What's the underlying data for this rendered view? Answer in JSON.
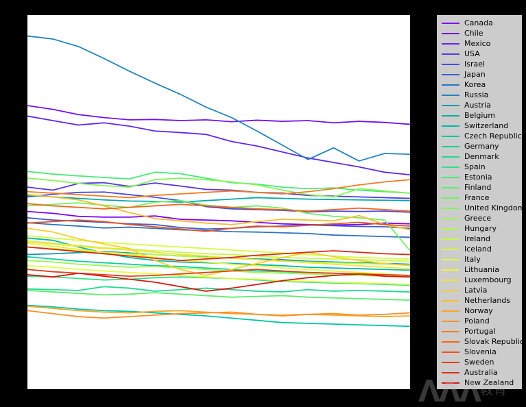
{
  "figure": {
    "background_color": "#000000",
    "plot_background_color": "#ffffff",
    "legend_background_color": "#cccccc"
  },
  "watermark": {
    "logo_text": "AAA",
    "text": "教育"
  },
  "chart_data": {
    "type": "line",
    "title": "",
    "xlabel": "",
    "ylabel": "",
    "grid": false,
    "legend_position": "right",
    "axis_ticks_visible": false,
    "axis_labels_visible": false,
    "xlim": [
      0,
      15
    ],
    "ylim": [
      0,
      100
    ],
    "x": [
      0,
      1,
      2,
      3,
      4,
      5,
      6,
      7,
      8,
      9,
      10,
      11,
      12,
      13,
      14,
      15
    ],
    "colormap": "rainbow",
    "series": [
      {
        "name": "Canada",
        "color": "#7d00ff",
        "values": [
          47.5,
          47.0,
          46.2,
          46.0,
          46.0,
          46.3,
          45.4,
          45.2,
          45.0,
          44.6,
          44.2,
          44.0,
          43.9,
          44.0,
          44.4,
          44.2
        ]
      },
      {
        "name": "Chile",
        "color": "#6f13f5",
        "values": [
          75.8,
          74.8,
          73.4,
          72.6,
          72.0,
          72.1,
          71.8,
          72.0,
          71.5,
          71.9,
          71.6,
          71.8,
          71.2,
          71.6,
          71.3,
          70.8
        ]
      },
      {
        "name": "Mexico",
        "color": "#6226ec",
        "values": [
          73.0,
          71.8,
          70.6,
          71.2,
          70.3,
          69.0,
          68.6,
          68.1,
          66.2,
          65.0,
          63.4,
          61.8,
          60.6,
          59.4,
          58.0,
          57.3
        ]
      },
      {
        "name": "USA",
        "color": "#5539e2",
        "values": [
          54.0,
          53.2,
          55.0,
          55.2,
          54.2,
          55.1,
          54.3,
          53.4,
          53.2,
          52.6,
          52.4,
          51.8,
          51.6,
          51.4,
          51.2,
          51.0
        ]
      },
      {
        "name": "Israel",
        "color": "#484cd9",
        "values": [
          51.4,
          52.1,
          52.6,
          52.7,
          52.0,
          51.3,
          50.4,
          48.8,
          48.2,
          48.0,
          47.8,
          47.4,
          47.6,
          47.5,
          47.6,
          47.3
        ]
      },
      {
        "name": "Japan",
        "color": "#3b5ecf",
        "values": [
          45.8,
          45.2,
          44.9,
          44.6,
          44.2,
          44.0,
          43.2,
          42.8,
          43.0,
          43.4,
          43.6,
          43.9,
          43.7,
          43.5,
          43.4,
          43.0
        ]
      },
      {
        "name": "Korea",
        "color": "#2e71c5",
        "values": [
          44.5,
          44.0,
          43.6,
          43.1,
          43.3,
          43.0,
          42.6,
          42.4,
          42.1,
          42.0,
          41.8,
          41.6,
          41.2,
          41.0,
          40.8,
          40.6
        ]
      },
      {
        "name": "Russia",
        "color": "#2184bb",
        "values": [
          94.4,
          93.6,
          91.6,
          88.4,
          85.0,
          81.8,
          78.8,
          75.4,
          72.6,
          69.0,
          65.2,
          61.4,
          64.5,
          61.0,
          63.0,
          62.8
        ]
      },
      {
        "name": "Austria",
        "color": "#1497b2",
        "values": [
          36.0,
          36.2,
          36.5,
          36.8,
          36.4,
          36.0,
          35.6,
          35.3,
          35.0,
          34.8,
          34.6,
          34.2,
          34.0,
          33.8,
          33.6,
          33.4
        ]
      },
      {
        "name": "Belgium",
        "color": "#07aaa8",
        "values": [
          51.8,
          51.4,
          51.0,
          50.6,
          50.3,
          50.2,
          50.0,
          50.4,
          50.8,
          51.2,
          51.0,
          50.8,
          50.7,
          50.6,
          50.5,
          50.4
        ]
      },
      {
        "name": "Switzerland",
        "color": "#00b9a5",
        "values": [
          40.4,
          39.8,
          38.0,
          36.4,
          35.2,
          34.4,
          34.0,
          33.8,
          33.6,
          33.3,
          33.0,
          32.6,
          32.4,
          32.2,
          32.0,
          31.8
        ]
      },
      {
        "name": "Czech Republic",
        "color": "#00c6a3",
        "values": [
          22.4,
          22.0,
          21.4,
          21.0,
          20.8,
          20.4,
          20.0,
          19.6,
          19.0,
          18.4,
          17.8,
          17.6,
          17.4,
          17.2,
          17.0,
          16.8
        ]
      },
      {
        "name": "Germany",
        "color": "#0ad09b",
        "values": [
          35.4,
          34.8,
          34.2,
          33.8,
          33.4,
          33.0,
          32.8,
          32.4,
          32.0,
          31.6,
          31.4,
          31.2,
          31.0,
          30.8,
          30.6,
          30.4
        ]
      },
      {
        "name": "Denmark",
        "color": "#1ed98f",
        "values": [
          26.8,
          26.6,
          26.4,
          27.4,
          27.0,
          26.2,
          26.6,
          27.0,
          26.6,
          26.2,
          26.0,
          26.6,
          26.2,
          26.4,
          26.2,
          26.0
        ]
      },
      {
        "name": "Spain",
        "color": "#33e283",
        "values": [
          30.2,
          30.0,
          29.6,
          29.2,
          29.4,
          29.8,
          30.0,
          29.8,
          29.6,
          29.2,
          28.8,
          28.6,
          28.4,
          28.2,
          28.0,
          27.8
        ]
      },
      {
        "name": "Estonia",
        "color": "#47e877",
        "values": [
          58.2,
          57.5,
          57.0,
          56.6,
          56.2,
          58.0,
          57.6,
          56.4,
          55.2,
          54.8,
          54.0,
          53.6,
          53.8,
          53.2,
          52.8,
          52.4
        ]
      },
      {
        "name": "Finland",
        "color": "#5ced6c",
        "values": [
          26.4,
          26.0,
          25.6,
          25.2,
          25.4,
          25.8,
          25.4,
          25.0,
          24.6,
          24.8,
          25.0,
          24.6,
          24.4,
          24.2,
          24.0,
          23.8
        ]
      },
      {
        "name": "France",
        "color": "#70f161",
        "values": [
          49.0,
          49.4,
          49.8,
          49.2,
          48.6,
          50.0,
          50.4,
          49.2,
          48.6,
          49.0,
          48.4,
          47.0,
          46.2,
          45.8,
          45.2,
          37.0
        ]
      },
      {
        "name": "United Kingdom",
        "color": "#85f557",
        "values": [
          56.4,
          55.8,
          55.0,
          54.4,
          54.0,
          56.0,
          56.4,
          56.0,
          55.4,
          54.6,
          53.2,
          52.0,
          51.4,
          53.6,
          53.0,
          52.4
        ]
      },
      {
        "name": "Greece",
        "color": "#9af84e",
        "values": [
          34.4,
          34.0,
          33.4,
          33.0,
          32.6,
          32.8,
          32.4,
          32.0,
          31.6,
          31.2,
          31.0,
          30.8,
          30.6,
          30.4,
          30.2,
          30.0
        ]
      },
      {
        "name": "Hungary",
        "color": "#affa47",
        "values": [
          38.0,
          37.6,
          37.0,
          36.6,
          36.2,
          36.0,
          35.6,
          35.2,
          35.0,
          34.6,
          34.2,
          34.0,
          33.8,
          33.6,
          33.4,
          33.2
        ]
      },
      {
        "name": "Ireland",
        "color": "#c2fc41",
        "values": [
          39.6,
          39.0,
          38.4,
          37.8,
          37.4,
          37.0,
          36.6,
          36.2,
          36.0,
          35.6,
          35.2,
          35.0,
          34.8,
          34.6,
          34.4,
          34.2
        ]
      },
      {
        "name": "Iceland",
        "color": "#d4fd3c",
        "values": [
          41.0,
          40.4,
          39.8,
          39.2,
          38.8,
          38.4,
          38.0,
          37.6,
          37.2,
          36.8,
          36.4,
          36.0,
          35.6,
          35.2,
          35.0,
          34.8
        ]
      },
      {
        "name": "Italy",
        "color": "#e2fe38",
        "values": [
          33.0,
          32.6,
          32.0,
          31.6,
          31.2,
          30.8,
          30.4,
          30.0,
          29.6,
          29.4,
          29.0,
          28.8,
          28.6,
          28.4,
          28.2,
          28.0
        ]
      },
      {
        "name": "Lithuania",
        "color": "#ecf335",
        "values": [
          39.0,
          38.2,
          37.4,
          36.6,
          36.0,
          35.2,
          34.4,
          34.0,
          33.4,
          33.0,
          32.4,
          32.0,
          31.6,
          31.2,
          30.8,
          30.4
        ]
      },
      {
        "name": "Luxembourg",
        "color": "#f3e232",
        "values": [
          39.4,
          38.8,
          38.2,
          37.6,
          37.2,
          36.6,
          36.0,
          35.6,
          35.0,
          34.6,
          34.2,
          33.8,
          33.4,
          33.0,
          32.6,
          32.2
        ]
      },
      {
        "name": "Latvia",
        "color": "#f7cd2e",
        "values": [
          43.0,
          42.0,
          40.2,
          38.8,
          37.6,
          34.4,
          32.0,
          30.4,
          32.0,
          33.6,
          35.2,
          36.6,
          35.4,
          34.4,
          33.6,
          33.0
        ]
      },
      {
        "name": "Netherlands",
        "color": "#faba2a",
        "values": [
          52.0,
          51.4,
          50.6,
          49.0,
          47.2,
          45.6,
          45.0,
          44.4,
          44.0,
          44.8,
          45.4,
          45.2,
          45.0,
          46.4,
          44.0,
          42.6
        ]
      },
      {
        "name": "Norway",
        "color": "#fba426",
        "values": [
          22.2,
          21.6,
          21.0,
          20.6,
          20.4,
          20.8,
          21.0,
          20.6,
          20.2,
          20.0,
          19.8,
          20.0,
          19.8,
          19.6,
          19.4,
          19.6
        ]
      },
      {
        "name": "Poland",
        "color": "#fa8f22",
        "values": [
          21.0,
          20.2,
          19.4,
          19.0,
          19.4,
          19.8,
          20.2,
          20.4,
          20.6,
          20.0,
          19.6,
          20.0,
          20.2,
          19.8,
          20.0,
          20.4
        ]
      },
      {
        "name": "Portugal",
        "color": "#f8791f",
        "values": [
          52.8,
          52.4,
          52.0,
          51.6,
          51.2,
          51.8,
          52.2,
          52.6,
          53.0,
          52.6,
          52.2,
          52.8,
          53.6,
          54.6,
          55.4,
          56.0
        ]
      },
      {
        "name": "Slovak Republic",
        "color": "#f4641b",
        "values": [
          49.6,
          49.0,
          48.6,
          48.2,
          48.6,
          49.0,
          49.4,
          49.0,
          48.6,
          48.2,
          48.0,
          47.6,
          48.0,
          48.4,
          48.0,
          47.6
        ]
      },
      {
        "name": "Slovenia",
        "color": "#ef5018",
        "values": [
          44.4,
          44.8,
          45.2,
          44.8,
          44.0,
          43.4,
          42.8,
          42.2,
          43.0,
          43.6,
          43.4,
          43.8,
          44.2,
          44.6,
          44.0,
          43.6
        ]
      },
      {
        "name": "Sweden",
        "color": "#e83c15",
        "values": [
          32.0,
          31.4,
          31.0,
          30.6,
          30.2,
          30.4,
          30.8,
          31.2,
          31.6,
          32.0,
          31.6,
          31.2,
          31.0,
          30.8,
          30.6,
          30.4
        ]
      },
      {
        "name": "Australia",
        "color": "#e02912",
        "values": [
          38.0,
          37.4,
          36.8,
          36.2,
          35.6,
          35.0,
          34.4,
          34.8,
          35.2,
          35.8,
          36.2,
          36.6,
          37.0,
          36.6,
          36.2,
          36.0
        ]
      },
      {
        "name": "New Zealand",
        "color": "#d8180f",
        "values": [
          30.6,
          30.0,
          31.0,
          30.2,
          29.4,
          28.6,
          27.4,
          26.2,
          27.0,
          28.0,
          29.0,
          29.8,
          30.4,
          30.8,
          30.2,
          30.0
        ]
      }
    ]
  }
}
